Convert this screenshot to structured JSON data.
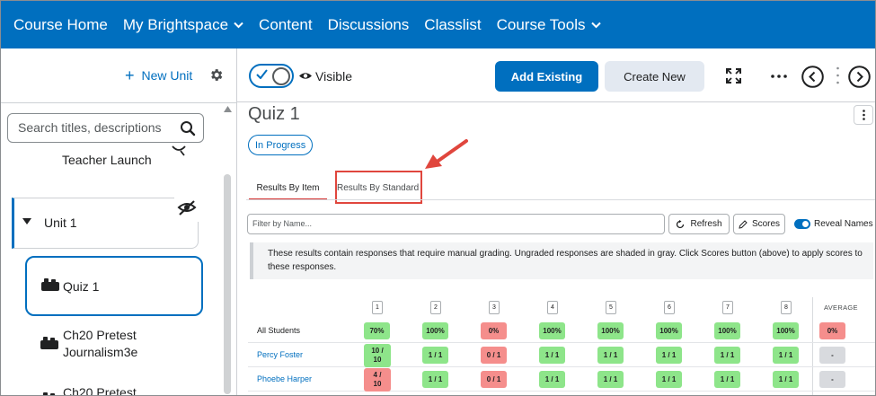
{
  "nav": {
    "items": [
      "Course Home",
      "My Brightspace",
      "Content",
      "Discussions",
      "Classlist",
      "Course Tools"
    ],
    "dropdown_flags": [
      false,
      true,
      false,
      false,
      false,
      true
    ],
    "color": "#006fbf"
  },
  "sidebar": {
    "new_unit_label": "New Unit",
    "search_placeholder": "Search titles, descriptions",
    "items": {
      "teacher_launch": "Teacher Launch",
      "unit1": "Unit 1",
      "quiz1": "Quiz 1",
      "pretest1_line1": "Ch20 Pretest",
      "pretest1_line2": "Journalism3e",
      "pretest2": "Ch20 Pretest"
    }
  },
  "toolbar": {
    "visibility_label": "Visible",
    "add_existing_label": "Add Existing",
    "create_new_label": "Create New"
  },
  "content": {
    "title": "Quiz 1",
    "status_badge": "In Progress",
    "tabs": [
      "Results By Item",
      "Results By Standard"
    ],
    "filter_placeholder": "Filter by Name...",
    "refresh_label": "Refresh",
    "scores_label": "Scores",
    "reveal_label": "Reveal Names",
    "notice": "These results contain responses that require manual grading. Ungraded responses are shaded in gray. Click Scores button (above) to apply scores to these responses."
  },
  "results": {
    "columns": [
      "1",
      "2",
      "3",
      "4",
      "5",
      "6",
      "7",
      "8"
    ],
    "average_label": "AVERAGE",
    "rows": [
      {
        "name": "All Students",
        "link": false,
        "cells": [
          {
            "text": "70%",
            "status": "correct"
          },
          {
            "text": "100%",
            "status": "correct"
          },
          {
            "text": "0%",
            "status": "incorrect"
          },
          {
            "text": "100%",
            "status": "correct"
          },
          {
            "text": "100%",
            "status": "correct"
          },
          {
            "text": "100%",
            "status": "correct"
          },
          {
            "text": "100%",
            "status": "correct"
          },
          {
            "text": "100%",
            "status": "correct"
          }
        ],
        "average": {
          "text": "0%",
          "status": "incorrect"
        }
      },
      {
        "name": "Percy Foster",
        "link": true,
        "cells": [
          {
            "text": "10 / 10",
            "status": "correct"
          },
          {
            "text": "1 / 1",
            "status": "correct"
          },
          {
            "text": "0 / 1",
            "status": "incorrect"
          },
          {
            "text": "1 / 1",
            "status": "correct"
          },
          {
            "text": "1 / 1",
            "status": "correct"
          },
          {
            "text": "1 / 1",
            "status": "correct"
          },
          {
            "text": "1 / 1",
            "status": "correct"
          },
          {
            "text": "1 / 1",
            "status": "correct"
          }
        ],
        "average": {
          "text": "-",
          "status": "ungraded"
        }
      },
      {
        "name": "Phoebe Harper",
        "link": true,
        "cells": [
          {
            "text": "4 / 10",
            "status": "incorrect"
          },
          {
            "text": "1 / 1",
            "status": "correct"
          },
          {
            "text": "0 / 1",
            "status": "incorrect"
          },
          {
            "text": "1 / 1",
            "status": "correct"
          },
          {
            "text": "1 / 1",
            "status": "correct"
          },
          {
            "text": "1 / 1",
            "status": "correct"
          },
          {
            "text": "1 / 1",
            "status": "correct"
          },
          {
            "text": "1 / 1",
            "status": "correct"
          }
        ],
        "average": {
          "text": "-",
          "status": "ungraded"
        }
      }
    ],
    "colors": {
      "correct": "#8ee58a",
      "incorrect": "#f58e8c",
      "ungraded": "#d8dade"
    }
  },
  "icons": [
    "chevron-down-icon",
    "plus-icon",
    "gear-icon",
    "search-icon",
    "hidden-eye-icon",
    "caret-down-icon",
    "quiz-icon",
    "checkmark-icon",
    "eye-icon",
    "expand-icon",
    "more-icon",
    "prev-icon",
    "next-icon",
    "refresh-icon",
    "pencil-icon",
    "arrow-annotation"
  ]
}
